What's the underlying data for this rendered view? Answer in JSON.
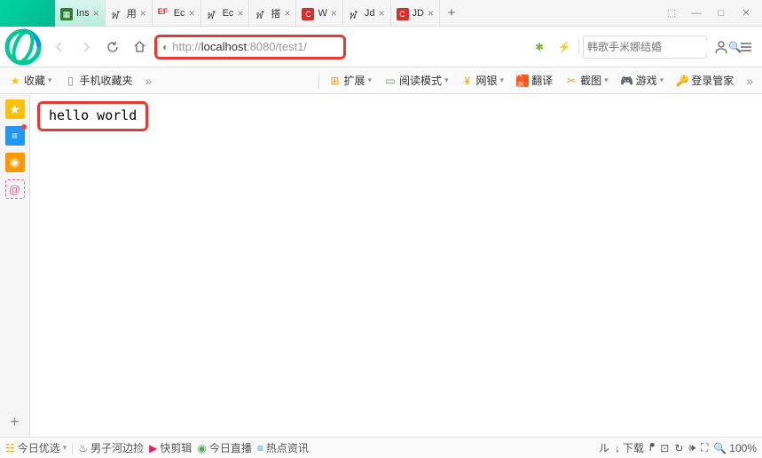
{
  "tabs": [
    {
      "label": "Ins",
      "iconBg": "#2e7d32"
    },
    {
      "label": "用",
      "iconText": "ฬ"
    },
    {
      "label": "Ec",
      "iconText": "EF"
    },
    {
      "label": "Ec",
      "iconText": "ฬ"
    },
    {
      "label": "搭",
      "iconText": "ฬ"
    },
    {
      "label": "W",
      "iconBg": "#d32f2f",
      "iconLetter": "C"
    },
    {
      "label": "Jd",
      "iconText": "ฬ"
    },
    {
      "label": "JD",
      "iconBg": "#d32f2f",
      "iconLetter": "C"
    }
  ],
  "window": {
    "skin": "⬚",
    "min": "—",
    "max": "□",
    "close": "✕"
  },
  "address": {
    "prefix": "http://",
    "host": "localhost",
    "rest": ":8080/test1/"
  },
  "search": {
    "placeholder": "韩歌手米娜结婚"
  },
  "bookmarks": {
    "fav": "收藏",
    "mobile": "手机收藏夹",
    "tools": [
      {
        "label": "扩展",
        "icon": "⊞",
        "color": "#ff9800"
      },
      {
        "label": "阅读模式",
        "icon": "▭",
        "color": "#4caf50"
      },
      {
        "label": "网银",
        "icon": "¥",
        "color": "#ff9800"
      },
      {
        "label": "翻译",
        "icon": "Aあ",
        "color": "#ff5722"
      },
      {
        "label": "截图",
        "icon": "✂",
        "color": "#ff9800"
      },
      {
        "label": "游戏",
        "icon": "🎮",
        "color": "#4caf50"
      },
      {
        "label": "登录管家",
        "icon": "🔑",
        "color": "#ff9800"
      }
    ]
  },
  "page": {
    "text": "hello world"
  },
  "status": {
    "left": [
      {
        "label": "今日优选",
        "icon": "☷",
        "color": "#ff9800"
      },
      {
        "label": "男子河边捡",
        "icon": "♨",
        "color": "#333"
      },
      {
        "label": "快剪辑",
        "icon": "▶",
        "color": "#e91e63"
      },
      {
        "label": "今日直播",
        "icon": "◉",
        "color": "#4caf50"
      },
      {
        "label": "热点资讯",
        "icon": "≡",
        "color": "#2196f3"
      }
    ],
    "right": {
      "mute": "ル",
      "download": "下载",
      "bookmark": "ᖰ",
      "pip": "⊡",
      "restore": "↻",
      "speaker": "🕪",
      "expand": "⛶",
      "zoom": "100%"
    }
  }
}
